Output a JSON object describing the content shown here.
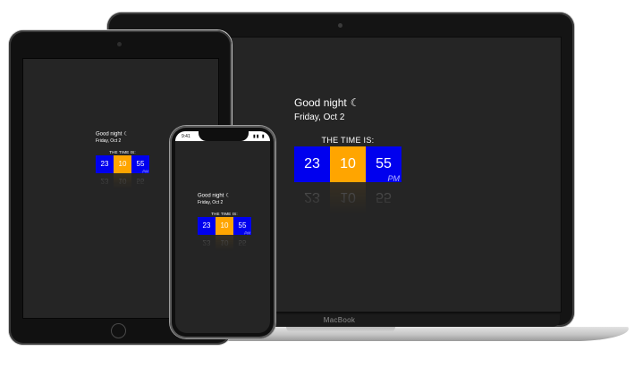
{
  "laptop": {
    "brand": "MacBook"
  },
  "clock": {
    "greeting": "Good night",
    "greeting_icon": "moon-icon",
    "greeting_icon_glyph": "☾",
    "date": "Friday, Oct 2",
    "time_label": "THE TIME IS:",
    "hours": "23",
    "minutes": "10",
    "seconds": "55",
    "ampm": "PM"
  },
  "phone_status": {
    "time": "9:41",
    "icons": "▮▮ ▮"
  },
  "colors": {
    "hours": "#0000ee",
    "minutes": "#ffa500",
    "seconds": "#0000ee",
    "screen_bg": "#252525"
  }
}
